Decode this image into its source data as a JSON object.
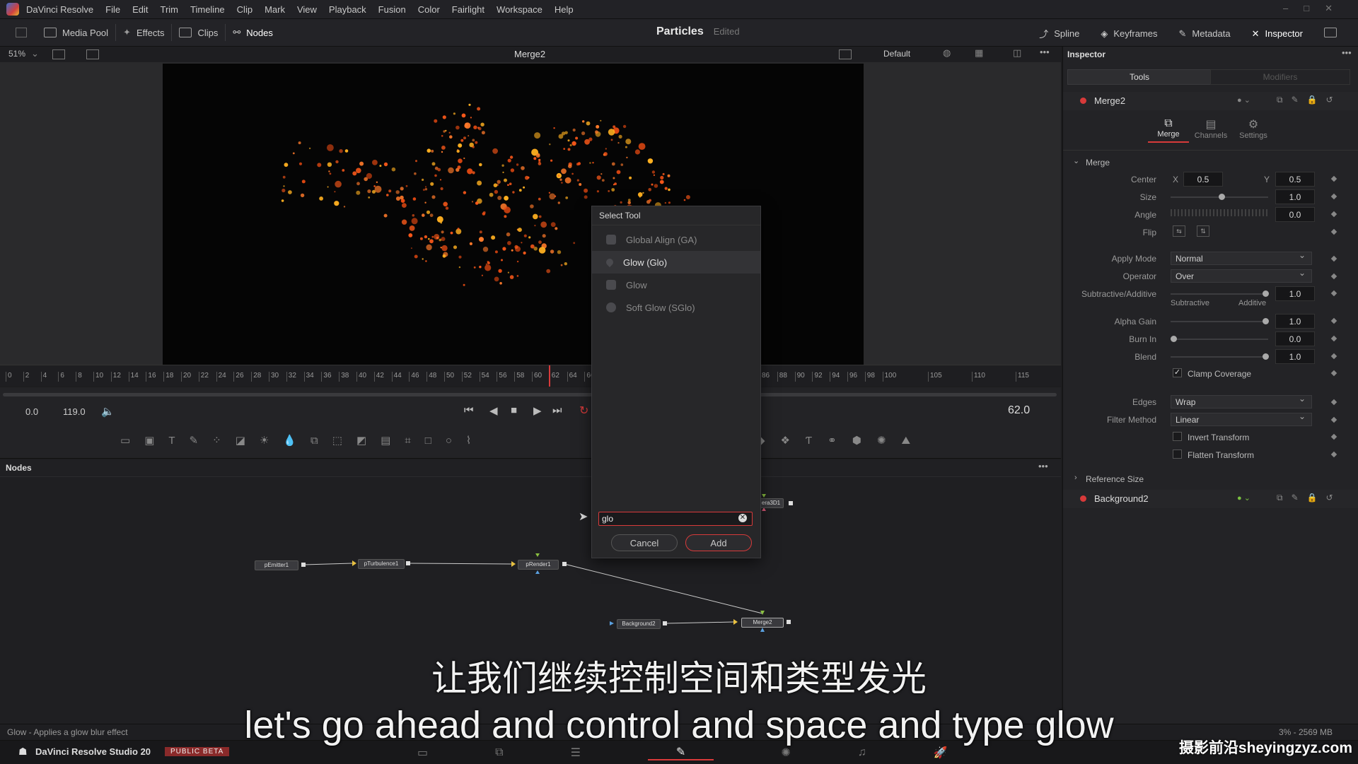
{
  "menubar": {
    "app_name": "DaVinci Resolve",
    "items": [
      "File",
      "Edit",
      "Trim",
      "Timeline",
      "Clip",
      "Mark",
      "View",
      "Playback",
      "Fusion",
      "Color",
      "Fairlight",
      "Workspace",
      "Help"
    ]
  },
  "toolbar": {
    "media_pool": "Media Pool",
    "effects": "Effects",
    "clips": "Clips",
    "nodes": "Nodes",
    "project_title": "Particles",
    "project_status": "Edited",
    "spline": "Spline",
    "keyframes": "Keyframes",
    "metadata": "Metadata",
    "inspector": "Inspector"
  },
  "viewer": {
    "zoom": "51%",
    "name": "Merge2",
    "lut": "Default"
  },
  "ruler": {
    "ticks": [
      "0",
      "2",
      "4",
      "6",
      "8",
      "10",
      "12",
      "14",
      "16",
      "18",
      "20",
      "22",
      "24",
      "26",
      "28",
      "30",
      "32",
      "34",
      "36",
      "38",
      "40",
      "42",
      "44",
      "46",
      "48",
      "50",
      "52",
      "54",
      "56",
      "58",
      "60",
      "62",
      "64",
      "66",
      "86",
      "88",
      "90",
      "92",
      "94",
      "96",
      "98",
      "100",
      "105",
      "110",
      "115"
    ]
  },
  "transport": {
    "start": "0.0",
    "end": "119.0",
    "current_frame": "62.0"
  },
  "nodes_panel": {
    "title": "Nodes",
    "nodes": [
      "pEmitter1",
      "pTurbulence1",
      "pRender1",
      "Background2",
      "Merge2",
      "era3D1"
    ]
  },
  "dialog": {
    "title": "Select Tool",
    "items": [
      {
        "label": "Global Align (GA)",
        "selected": false
      },
      {
        "label": "Glow (Glo)",
        "selected": true
      },
      {
        "label": "Glow",
        "selected": false
      },
      {
        "label": "Soft Glow (SGlo)",
        "selected": false
      }
    ],
    "search_value": "glo",
    "cancel": "Cancel",
    "add": "Add"
  },
  "inspector": {
    "title": "Inspector",
    "tabs": [
      "Tools",
      "Modifiers"
    ],
    "node_name": "Merge2",
    "subtabs": [
      "Merge",
      "Channels",
      "Settings"
    ],
    "section": "Merge",
    "center_label": "Center",
    "x_label": "X",
    "y_label": "Y",
    "center_x": "0.5",
    "center_y": "0.5",
    "size_label": "Size",
    "size": "1.0",
    "angle_label": "Angle",
    "angle": "0.0",
    "flip_label": "Flip",
    "apply_mode_label": "Apply Mode",
    "apply_mode": "Normal",
    "operator_label": "Operator",
    "operator": "Over",
    "subadd_label": "Subtractive/Additive",
    "subadd": "1.0",
    "subtractive": "Subtractive",
    "additive": "Additive",
    "alpha_gain_label": "Alpha Gain",
    "alpha_gain": "1.0",
    "burn_in_label": "Burn In",
    "burn_in": "0.0",
    "blend_label": "Blend",
    "blend": "1.0",
    "clamp_coverage": "Clamp Coverage",
    "edges_label": "Edges",
    "edges": "Wrap",
    "filter_method_label": "Filter Method",
    "filter_method": "Linear",
    "invert_transform": "Invert Transform",
    "flatten_transform": "Flatten Transform",
    "reference_size": "Reference Size",
    "node2_name": "Background2"
  },
  "status": {
    "left": "Glow - Applies a glow blur effect",
    "right": "3% - 2569 MB"
  },
  "bottombar": {
    "product": "DaVinci Resolve Studio 20",
    "badge": "PUBLIC BETA"
  },
  "subtitles": {
    "chinese": "让我们继续控制空间和类型发光",
    "english": "let's go ahead and control and space and type glow"
  },
  "watermark": "摄影前沿sheyingzyz.com",
  "colors": {
    "accent_red": "#d83a3a",
    "particle_orange": "#ff5a1a",
    "particle_yellow": "#ffb020"
  }
}
